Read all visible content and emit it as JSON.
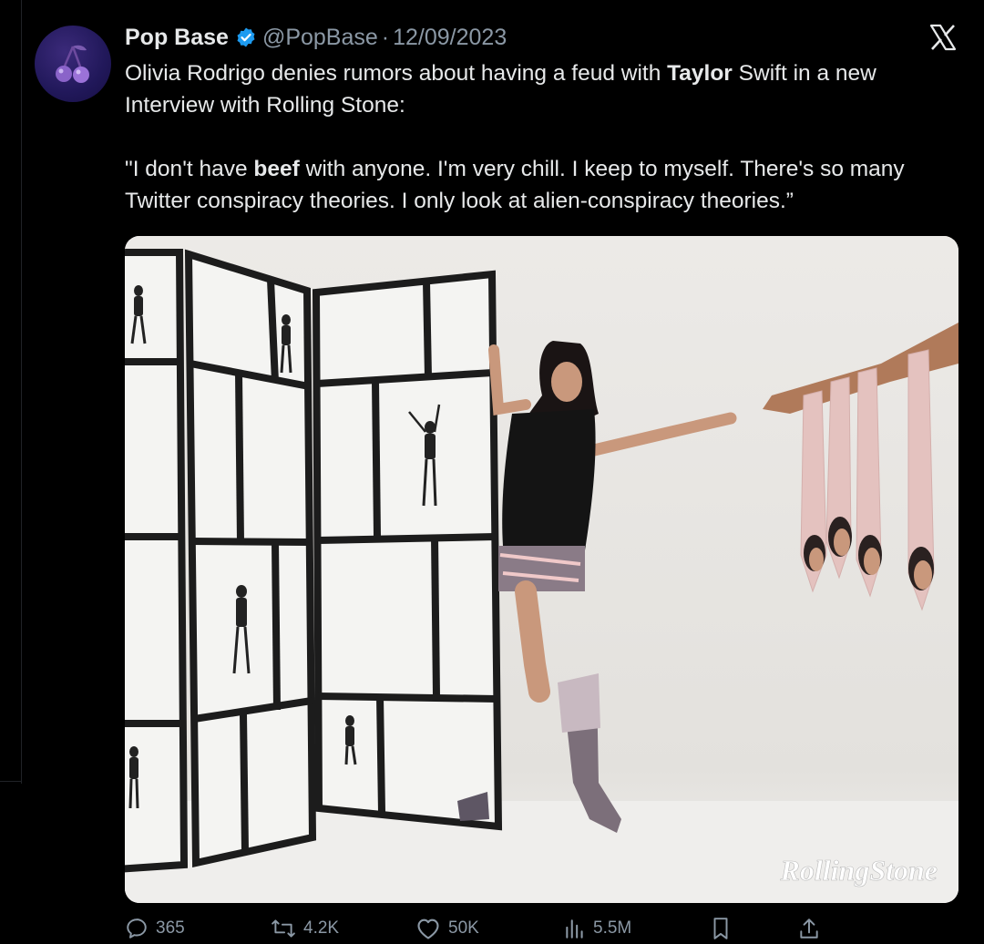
{
  "tweet": {
    "author_name": "Pop Base",
    "handle": "@PopBase",
    "separator": "·",
    "date": "12/09/2023",
    "text_part1": "Olivia Rodrigo denies rumors about having a feud with ",
    "text_bold1": "Taylor",
    "text_part2": " Swift in a new Interview with Rolling Stone:",
    "quote_part1": "\"I don't have ",
    "quote_bold": "beef",
    "quote_part2": " with anyone. I'm very chill. I keep to myself. There's so many Twitter conspiracy theories. I only look at alien-conspiracy theories.”",
    "image_watermark": "RollingStone"
  },
  "actions": {
    "replies": "365",
    "reposts": "4.2K",
    "likes": "50K",
    "views": "5.5M"
  },
  "icons": {
    "avatar": "cherry-icon",
    "verified": "verified-badge-icon",
    "platform": "x-logo-icon",
    "reply": "reply-icon",
    "repost": "repost-icon",
    "like": "heart-icon",
    "views": "views-icon",
    "bookmark": "bookmark-icon",
    "share": "share-icon"
  },
  "colors": {
    "background": "#000000",
    "text": "#e7e9ea",
    "secondary": "#8b98a5",
    "verified": "#1d9bf0"
  }
}
